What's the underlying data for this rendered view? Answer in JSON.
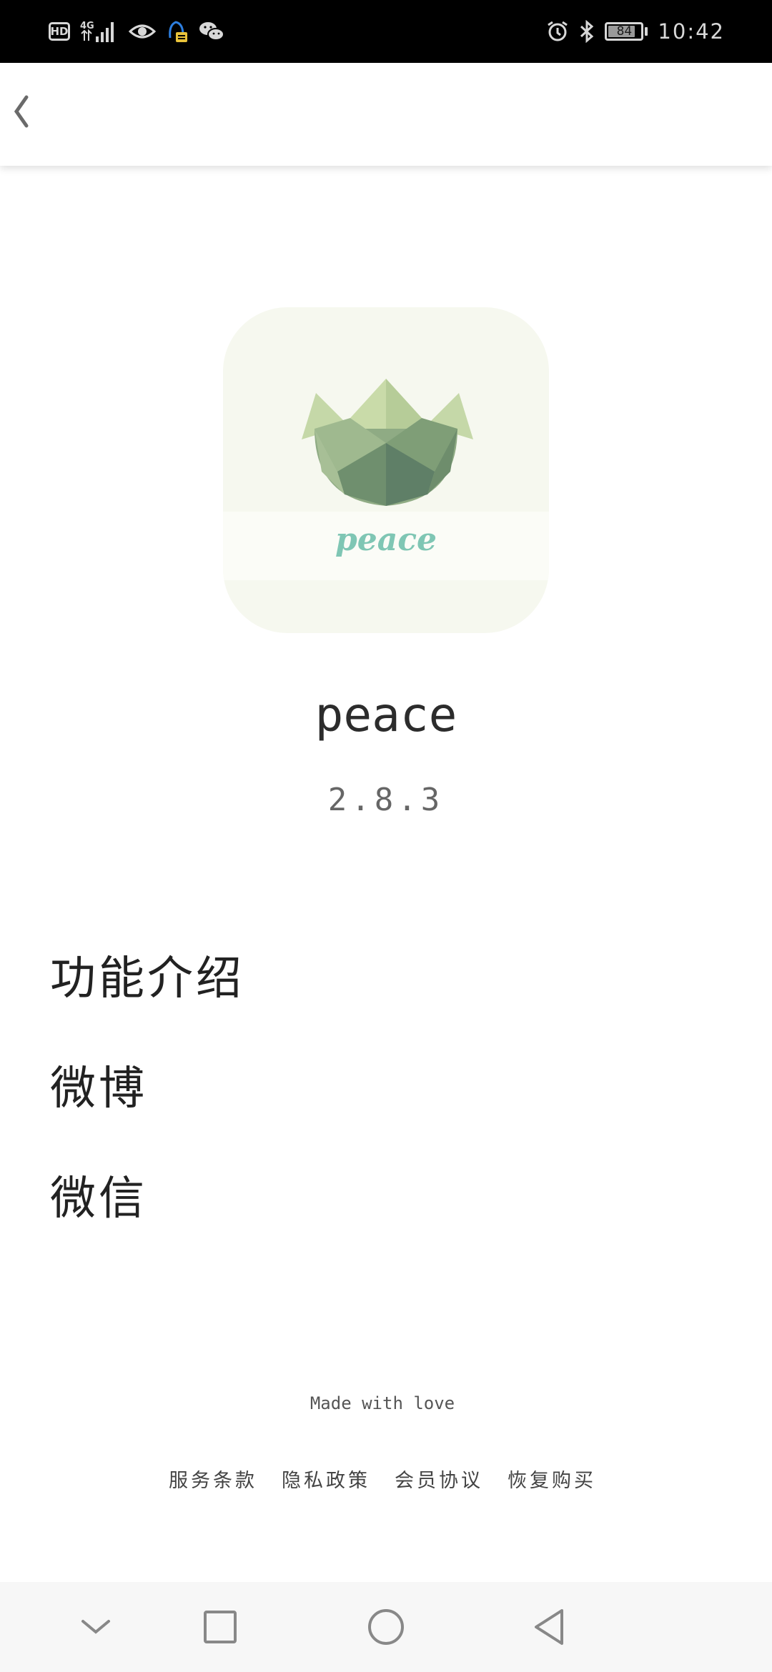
{
  "status_bar": {
    "left_icons": [
      "hd-icon",
      "signal-4g-icon",
      "eye-icon",
      "qq-icon",
      "wechat-icon"
    ],
    "hd_label": "HD",
    "network_label": "4G",
    "right_icons": [
      "alarm-icon",
      "bluetooth-icon",
      "battery-icon"
    ],
    "battery_level": "84",
    "battery_fraction": 0.84,
    "time": "10:42"
  },
  "app_bar": {
    "back_label": "‹",
    "back_icon": "chevron-left-icon"
  },
  "about": {
    "icon_caption": "peace",
    "app_name": "peace",
    "version": "2.8.3",
    "icon_colors": {
      "background": "#f6f8ef",
      "leaf_light": "#c5d8a8",
      "leaf_mid": "#8fab84",
      "leaf_dark": "#5f7f67",
      "caption": "#7fc6b4"
    }
  },
  "menu": {
    "items": [
      {
        "label": "功能介绍"
      },
      {
        "label": "微博"
      },
      {
        "label": "微信"
      }
    ]
  },
  "footer": {
    "note": "Made with love",
    "links": [
      {
        "label": "服务条款"
      },
      {
        "label": "隐私政策"
      },
      {
        "label": "会员协议"
      },
      {
        "label": "恢复购买"
      }
    ]
  },
  "nav_bar": {
    "buttons": [
      "chevron-down-icon",
      "recents-square-icon",
      "home-circle-icon",
      "back-triangle-icon"
    ]
  }
}
